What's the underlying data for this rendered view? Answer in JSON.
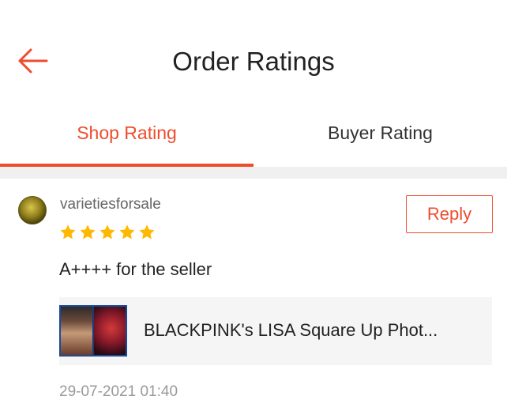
{
  "header": {
    "title": "Order Ratings"
  },
  "tabs": [
    {
      "label": "Shop Rating",
      "active": true
    },
    {
      "label": "Buyer Rating",
      "active": false
    }
  ],
  "colors": {
    "accent": "#ee4d2d",
    "star": "#ffb800",
    "divider": "#f0f0f0"
  },
  "review": {
    "username": "varietiesforsale",
    "rating": 5,
    "rating_max": 5,
    "reply_label": "Reply",
    "comment": "A++++ for the seller",
    "product_name": "BLACKPINK's LISA Square Up Phot...",
    "timestamp": "29-07-2021 01:40"
  },
  "icons": {
    "back": "arrow-left-icon",
    "star": "star-icon"
  }
}
